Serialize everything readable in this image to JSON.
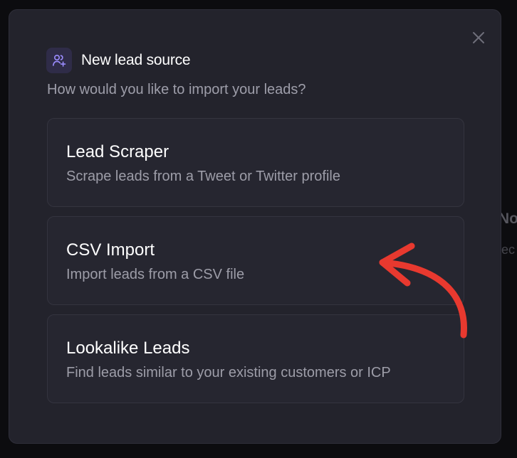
{
  "background": {
    "title_fragment": "No",
    "subtitle_fragment": "lec"
  },
  "modal": {
    "title": "New lead source",
    "subtitle": "How would you like to import your leads?",
    "icon": "users-plus-icon",
    "close_icon": "close-icon",
    "options": [
      {
        "title": "Lead Scraper",
        "description": "Scrape leads from a Tweet or Twitter profile"
      },
      {
        "title": "CSV Import",
        "description": "Import leads from a CSV file"
      },
      {
        "title": "Lookalike Leads",
        "description": "Find leads similar to your existing customers or ICP"
      }
    ]
  },
  "colors": {
    "modal_bg": "#23232c",
    "option_bg": "#262630",
    "icon_accent": "#8b7cf6",
    "annotation": "#e8392f"
  }
}
